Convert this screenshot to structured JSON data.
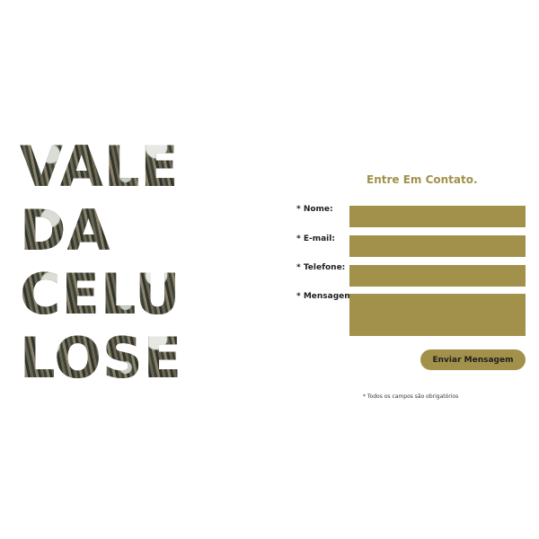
{
  "title": {
    "lines": [
      "VALE",
      "DA",
      "CELU",
      "LOSE"
    ]
  },
  "form": {
    "heading": "Entre Em Contato.",
    "fields": [
      {
        "label": "* Nome:",
        "value": ""
      },
      {
        "label": "* E-mail:",
        "value": ""
      },
      {
        "label": "* Telefone:",
        "value": ""
      },
      {
        "label": "* Mensagem:",
        "value": ""
      }
    ],
    "submit_label": "Enviar Mensagem",
    "footnote": "* Todos os campos são obrigatórios"
  },
  "colors": {
    "accent": "#a2914a",
    "text": "#1e1e1e",
    "background": "#ffffff"
  }
}
